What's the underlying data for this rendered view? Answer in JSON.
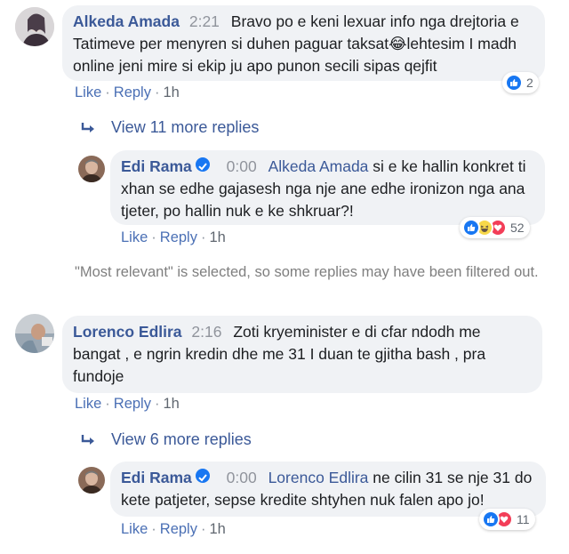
{
  "comments": [
    {
      "author": "Alkeda Amada",
      "time": "2:21",
      "text": "Bravo po e keni lexuar info nga drejtoria e Tatimeve per menyren si duhen paguar taksat",
      "emoji": "😂",
      "text2": "lehtesim I madh online jeni mire si ekip ju apo punon secili sipas qejfit",
      "like": "Like",
      "reply": "Reply",
      "age": "1h",
      "reaction_count": "2",
      "view_more": "View 11 more replies"
    },
    {
      "author": "Lorenco Edlira",
      "time": "2:16",
      "text": "Zoti kryeminister e di cfar ndodh me bangat , e ngrin kredin dhe me 31 I duan te gjitha bash , pra fundoje",
      "like": "Like",
      "reply": "Reply",
      "age": "1h",
      "view_more": "View 6 more replies"
    }
  ],
  "replies": [
    {
      "author": "Edi Rama",
      "time": "0:00",
      "mention": "Alkeda Amada",
      "text": "si e ke hallin konkret ti xhan se edhe gajasesh nga nje ane edhe ironizon nga ana tjeter, po hallin nuk e ke shkruar?!",
      "like": "Like",
      "reply": "Reply",
      "age": "1h",
      "reaction_count": "52"
    },
    {
      "author": "Edi Rama",
      "time": "0:00",
      "mention": "Lorenco Edlira",
      "text": "ne cilin 31 se nje 31 do kete patjeter, sepse kredite shtyhen nuk falen apo jo!",
      "like": "Like",
      "reply": "Reply",
      "age": "1h",
      "reaction_count": "11"
    }
  ],
  "filter_notice": "\"Most relevant\" is selected, so some replies may have been filtered out.",
  "separator": "·",
  "colors": {
    "link": "#3b5998",
    "bubble": "#f0f2f5",
    "like": "#1877f2",
    "love": "#f33e58",
    "haha": "#f7d84a"
  }
}
